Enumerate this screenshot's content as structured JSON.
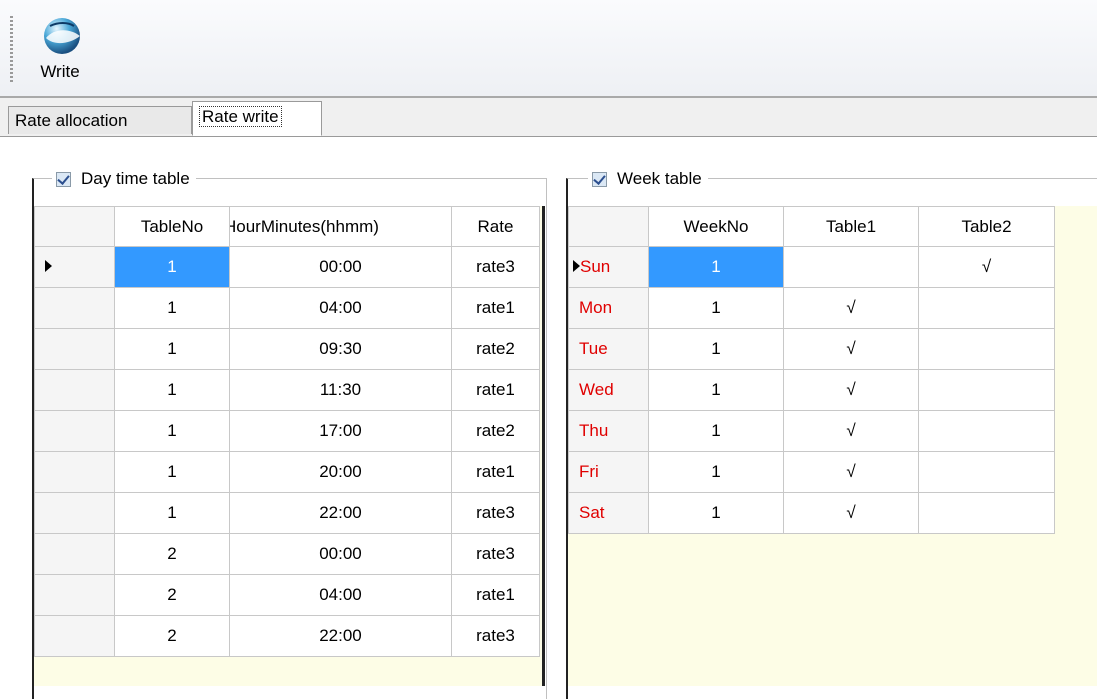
{
  "toolbar": {
    "write_label": "Write"
  },
  "tabs": [
    {
      "label": "Rate allocation"
    },
    {
      "label": "Rate write"
    }
  ],
  "day_group": {
    "title": "Day time table",
    "columns": [
      "TableNo",
      "HourMinutes(hhmm)",
      "Rate"
    ],
    "rows": [
      [
        "1",
        "00:00",
        "rate3"
      ],
      [
        "1",
        "04:00",
        "rate1"
      ],
      [
        "1",
        "09:30",
        "rate2"
      ],
      [
        "1",
        "11:30",
        "rate1"
      ],
      [
        "1",
        "17:00",
        "rate2"
      ],
      [
        "1",
        "20:00",
        "rate1"
      ],
      [
        "1",
        "22:00",
        "rate3"
      ],
      [
        "2",
        "00:00",
        "rate3"
      ],
      [
        "2",
        "04:00",
        "rate1"
      ],
      [
        "2",
        "22:00",
        "rate3"
      ]
    ]
  },
  "week_group": {
    "title": "Week table",
    "columns": [
      "WeekNo",
      "Table1",
      "Table2"
    ],
    "rows": [
      [
        "Sun",
        "1",
        "",
        "√"
      ],
      [
        "Mon",
        "1",
        "√",
        ""
      ],
      [
        "Tue",
        "1",
        "√",
        ""
      ],
      [
        "Wed",
        "1",
        "√",
        ""
      ],
      [
        "Thu",
        "1",
        "√",
        ""
      ],
      [
        "Fri",
        "1",
        "√",
        ""
      ],
      [
        "Sat",
        "1",
        "√",
        ""
      ]
    ]
  }
}
